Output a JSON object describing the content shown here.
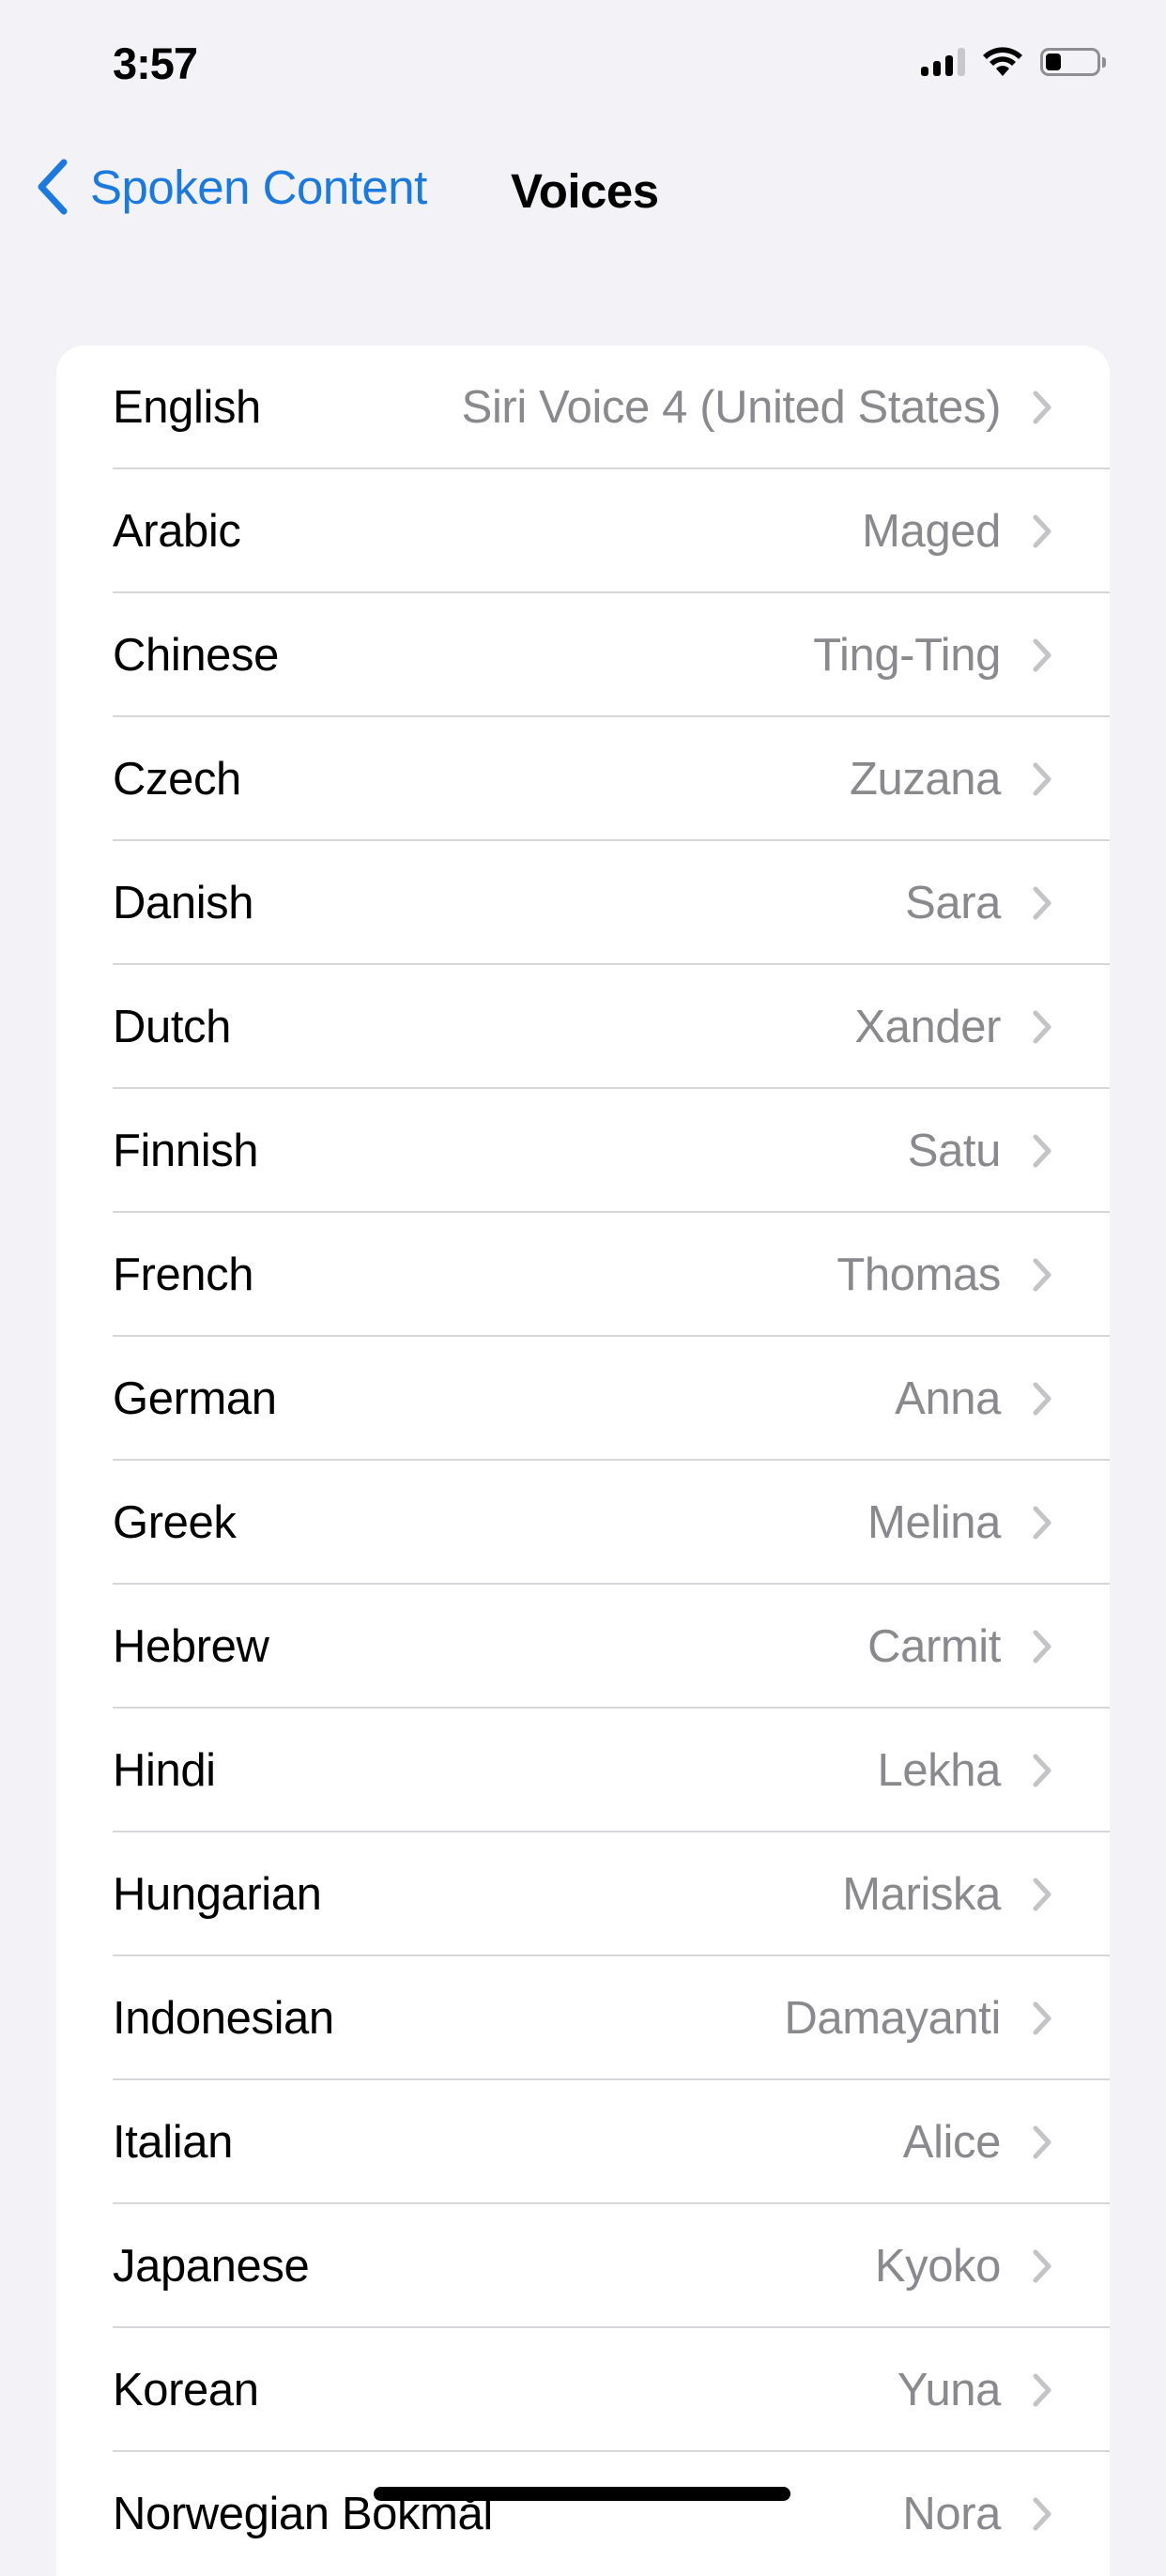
{
  "status_bar": {
    "time": "3:57",
    "signal_bars_filled": 3,
    "signal_bars_total": 4,
    "wifi_icon": "wifi-icon",
    "battery_level_percent": 30
  },
  "nav": {
    "back_label": "Spoken Content",
    "back_icon": "chevron-left-icon",
    "title": "Voices"
  },
  "colors": {
    "accent": "#1a7ae0",
    "background": "#f2f2f7",
    "card": "#ffffff",
    "secondary_text": "#8a8a8e",
    "separator": "#d6d6da"
  },
  "voices": [
    {
      "language": "English",
      "voice": "Siri Voice 4 (United States)"
    },
    {
      "language": "Arabic",
      "voice": "Maged"
    },
    {
      "language": "Chinese",
      "voice": "Ting-Ting"
    },
    {
      "language": "Czech",
      "voice": "Zuzana"
    },
    {
      "language": "Danish",
      "voice": "Sara"
    },
    {
      "language": "Dutch",
      "voice": "Xander"
    },
    {
      "language": "Finnish",
      "voice": "Satu"
    },
    {
      "language": "French",
      "voice": "Thomas"
    },
    {
      "language": "German",
      "voice": "Anna"
    },
    {
      "language": "Greek",
      "voice": "Melina"
    },
    {
      "language": "Hebrew",
      "voice": "Carmit"
    },
    {
      "language": "Hindi",
      "voice": "Lekha"
    },
    {
      "language": "Hungarian",
      "voice": "Mariska"
    },
    {
      "language": "Indonesian",
      "voice": "Damayanti"
    },
    {
      "language": "Italian",
      "voice": "Alice"
    },
    {
      "language": "Japanese",
      "voice": "Kyoko"
    },
    {
      "language": "Korean",
      "voice": "Yuna"
    },
    {
      "language": "Norwegian Bokmål",
      "voice": "Nora"
    }
  ]
}
